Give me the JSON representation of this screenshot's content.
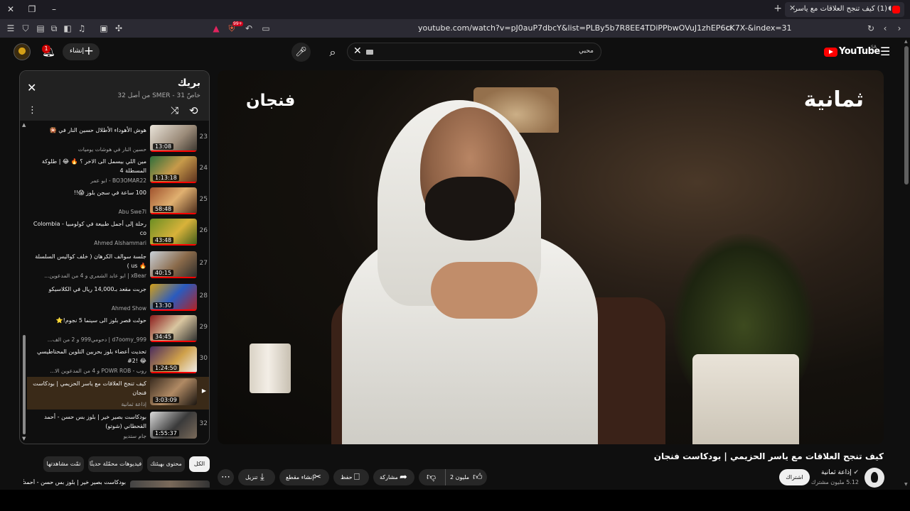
{
  "browser": {
    "tab_title": "(1) كيف تنجح العلاقات مع ياسر",
    "url": "youtube.com/watch?v=pJ0auP7dbcY&list=PLBy5b7R8EE4TDiPPbwOVuJ1zhEP6cK7X-&index=31",
    "extension_badge": "99+"
  },
  "header": {
    "notification_count": "1",
    "create_label": "إنشاء",
    "search_query": "محبي",
    "logo_text": "YouTube",
    "logo_region": "SA"
  },
  "playlist": {
    "title": "بريك",
    "subtitle": "خاصّ SMER - 31 من أصل 32",
    "items": [
      {
        "index": "23",
        "title": "هوش الأهوداء الأطلال حسين النار في 🎇",
        "channel": "حسين النار في هوشات يوميات",
        "duration": "13:08"
      },
      {
        "index": "24",
        "title": "مين اللي بيسمل الى الاخر ؟ 🔥 😂 | طلوكة المسطلة 4",
        "channel": "BO3OMAR22 - ابو عمر",
        "duration": "1:13:18"
      },
      {
        "index": "25",
        "title": "100 ساعة في سجن بلوز 😱!!",
        "channel": "Abu Swe7l",
        "duration": "58:48"
      },
      {
        "index": "26",
        "title": "رحلة إلى أجمل طبيعة في كولومبيا - Colombia co",
        "channel": "Ahmed Alshammari",
        "duration": "43:48"
      },
      {
        "index": "27",
        "title": "جلسة سوالف الكرهان ( خلف كواليس السلسلة 🔥 us )",
        "channel": "xBear | ابو عابد الشمري و 4 من المدعوين...",
        "duration": "40:15"
      },
      {
        "index": "28",
        "title": "جربت مقعد بـ14,000 ريال في الكلاسيكو",
        "channel": "Ahmed Show",
        "duration": "13:30"
      },
      {
        "index": "29",
        "title": "حولت قصر بلوز الى سينما 5 نجوم!⭐",
        "channel": "d7oomy_999 | دحومي999 و 2 من الف...",
        "duration": "34:45"
      },
      {
        "index": "30",
        "title": "تحديت أعضاء بلوز بحربين التلوين المحتاطيسي 😂 !2#",
        "channel": "روب - POWR ROB و 4 من المدعوين الا...",
        "duration": "1:24:50"
      },
      {
        "index": "",
        "title": "كيف تنجح العلاقات مع ياسر الحزيمي | بودكاست فنجان",
        "channel": "إذاعة ثمانية",
        "duration": "3:03:09",
        "active": true
      },
      {
        "index": "32",
        "title": "بودكاست بصير خير | بلوز بس حسن - أحمد القحطاني (شوتو)",
        "channel": "جام ستديو",
        "duration": "1:55:37"
      }
    ]
  },
  "player": {
    "logo_left": "فنجان",
    "logo_right": "ثمانية"
  },
  "video": {
    "title": "كيف تنجح العلاقات مع ياسر الحزيمي | بودكاست فنجان",
    "channel_name": "إذاعة ثمانية",
    "subscribers": "5.12 مليون مشترك",
    "subscribe_label": "اشتراك",
    "likes": "2 مليون",
    "share_label": "مشاركة",
    "save_label": "حفظ",
    "clip_label": "إنشاء مقطع",
    "download_label": "تنزيل"
  },
  "chips": {
    "all": "الكل",
    "related": "محتوى بهيئتك",
    "recent": "فيديوهات محمّلة حديثًا",
    "watched": "تمّت مشاهدتها"
  },
  "recommendation": {
    "title": "بودكاست بصير خير | بلوز بس حسن - أحمد"
  },
  "colors": {
    "accent": "#ff0000",
    "background": "#0f0f0f",
    "active_item": "#3a2a18"
  }
}
